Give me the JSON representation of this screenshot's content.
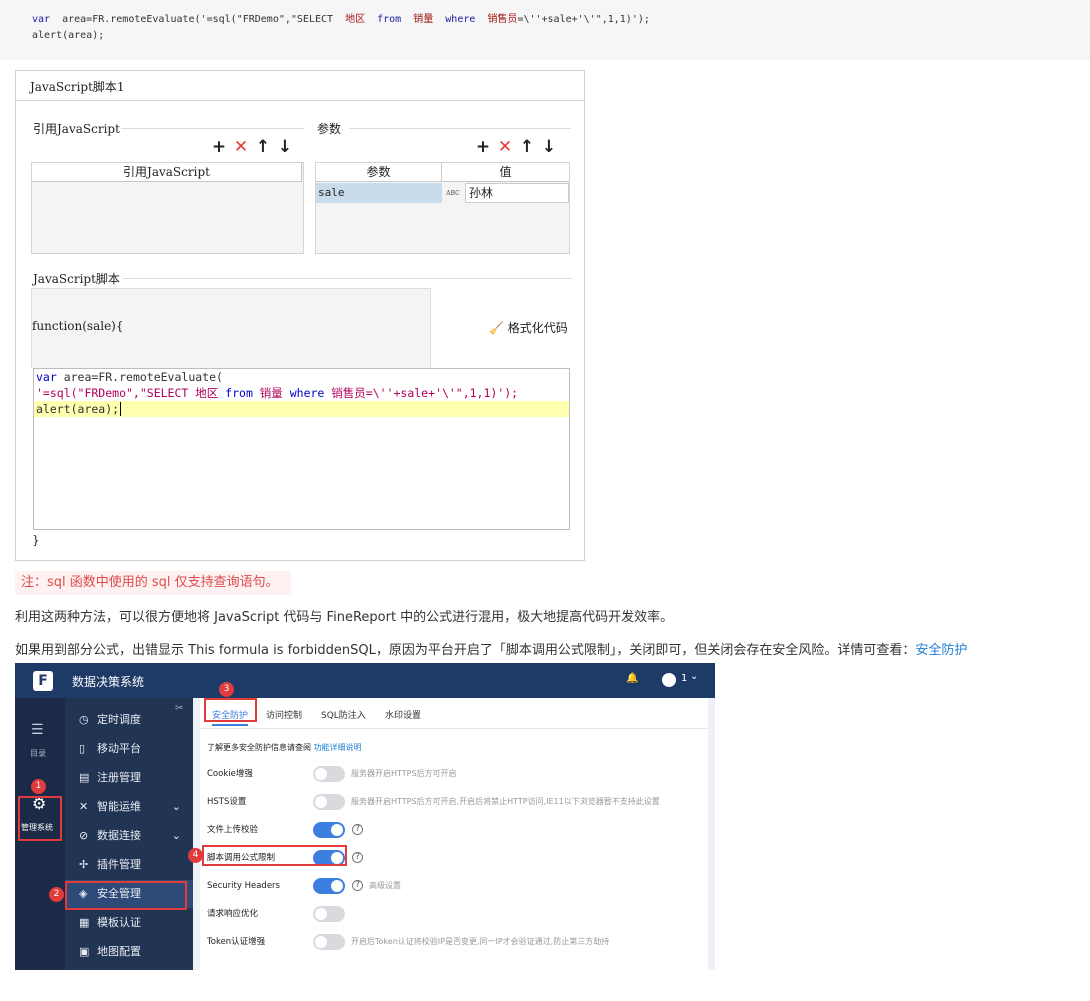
{
  "code_block": {
    "line1": {
      "kw": "var",
      "rest1": "  area=FR.remoteEvaluate('=sql(\"FRDemo\",\"SELECT  ",
      "cn1": "地区",
      "from": "  from  ",
      "cn2": "销量",
      "where": "  where  ",
      "cn3": "销售员",
      "rest2": "=\\''+sale+'\\'\",1,1)');"
    },
    "line2": "alert(area);"
  },
  "dialog": {
    "title": "JavaScript脚本1",
    "ref_group": "引用JavaScript",
    "ref_col": "引用JavaScript",
    "param_group": "参数",
    "param_col": "参数",
    "value_col": "值",
    "param_name": "sale",
    "param_type": "ABC",
    "param_value": "孙林",
    "script_group": "JavaScript脚本",
    "func_header": "function(sale){",
    "format_btn": "格式化代码",
    "func_close": "}",
    "toolbar": {
      "add": "+",
      "delete": "✕",
      "up": "↑",
      "down": "↓"
    },
    "editor": {
      "l1_kw": "var",
      "l1_rest": " area=FR.remoteEvaluate(",
      "l2_a": "'=sql(\"FRDemo\",\"SELECT 地区 ",
      "l2_from": "from",
      "l2_b": " 销量 ",
      "l2_where": "where",
      "l2_c": " 销售员=\\''+sale+'\\'\",1,1)');",
      "l3": "alert(area);"
    }
  },
  "note": "注：sql 函数中使用的 sql 仅支持查询语句。",
  "para1": "利用这两种方法，可以很方便地将 JavaScript 代码与 FineReport 中的公式进行混用，极大地提高代码开发效率。",
  "para2": "如果用到部分公式，出错显示 This formula is forbiddenSQL，原因为平台开启了「脚本调用公式限制」，关闭即可，但关闭会存在安全风险。详情可查看：",
  "para2_link": "安全防护",
  "app": {
    "title": "数据决策系统",
    "user": "1",
    "leftbar": {
      "dir": "目录",
      "manage": "管理系统"
    },
    "menu": [
      "定时调度",
      "移动平台",
      "注册管理",
      "智能运维",
      "数据连接",
      "插件管理",
      "安全管理",
      "模板认证",
      "地图配置"
    ],
    "tabs": [
      "安全防护",
      "访问控制",
      "SQL防注入",
      "水印设置"
    ],
    "intro": "了解更多安全防护信息请查阅",
    "intro_link": "功能详细说明",
    "settings": [
      {
        "label": "Cookie增强",
        "on": false,
        "desc": "服务器开启HTTPS后方可开启"
      },
      {
        "label": "HSTS设置",
        "on": false,
        "desc": "服务器开启HTTPS后方可开启,开启后将禁止HTTP访问,IE11以下浏览器暂不支持此设置"
      },
      {
        "label": "文件上传校验",
        "on": true,
        "desc": ""
      },
      {
        "label": "脚本调用公式限制",
        "on": true,
        "desc": ""
      },
      {
        "label": "Security Headers",
        "on": true,
        "desc": "高级设置"
      },
      {
        "label": "请求响应优化",
        "on": false,
        "desc": ""
      },
      {
        "label": "Token认证增强",
        "on": false,
        "desc": "开启后Token认证将校验IP是否变更,同一IP才会验证通过,防止第三方劫持"
      }
    ],
    "badges": [
      "1",
      "2",
      "3",
      "4"
    ],
    "help_glyph": "?",
    "colors": {
      "topbar": "#1e3a67",
      "menu": "#213453",
      "accent": "#3d7fe0",
      "highlight": "#e23b3b"
    }
  }
}
